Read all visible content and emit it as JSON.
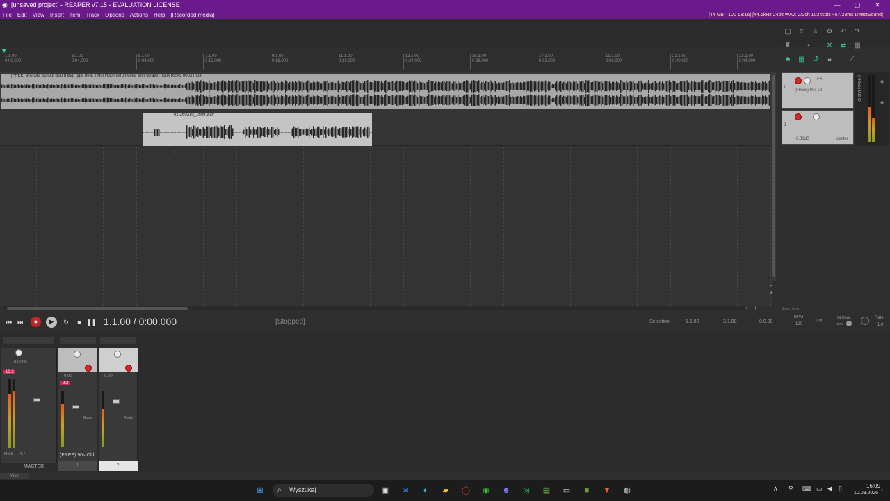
{
  "window": {
    "title": "[unsaved project] - REAPER v7.15 - EVALUATION LICENSE",
    "status_right": "[44 GB · 100 13:16] [44.1kHz 24bit WAV: 2/2ch 1024spls ~57/23ms DirectSound]",
    "controls": [
      "—",
      "▢",
      "✕"
    ]
  },
  "menu": [
    "File",
    "Edit",
    "View",
    "Insert",
    "Item",
    "Track",
    "Options",
    "Actions",
    "Help",
    "[Recorded media]"
  ],
  "ruler": {
    "ticks": [
      {
        "bar": "1.1.00",
        "time": "0:00.000"
      },
      {
        "bar": "3.1.00",
        "time": "0:04.000"
      },
      {
        "bar": "5.1.00",
        "time": "0:08.000"
      },
      {
        "bar": "7.1.00",
        "time": "0:12.000"
      },
      {
        "bar": "9.1.00",
        "time": "0:16.000"
      },
      {
        "bar": "11.1.00",
        "time": "0:20.000"
      },
      {
        "bar": "13.1.00",
        "time": "0:24.000"
      },
      {
        "bar": "15.1.00",
        "time": "0:28.000"
      },
      {
        "bar": "17.1.00",
        "time": "0:32.000"
      },
      {
        "bar": "19.1.00",
        "time": "0:36.000"
      },
      {
        "bar": "21.1.00",
        "time": "0:40.000"
      },
      {
        "bar": "23.1.00",
        "time": "0:44.000"
      }
    ]
  },
  "tracks": {
    "item1_label": "[FREE] 90s Old School Boom Bap type beat x Hip Hop instrumental with scratch hook REAL 0003.mp3",
    "item2_label": "02-260310_1609.wav",
    "tcp1": {
      "number": "1",
      "name": "(FREE) 90s Ol"
    },
    "tcp2": {
      "number": "2",
      "volume": "0.00dB",
      "pan": "center"
    }
  },
  "transport": {
    "position": "1.1.00 / 0:00.000",
    "state": "[Stopped]",
    "selection_label": "Selection:",
    "selection_start": "1.1.00",
    "selection_end": "3.1.00",
    "selection_length": "0.0.00",
    "bpm_label": "BPM",
    "bpm": "120",
    "timesig": "4/4",
    "global_label": "GLOBAL",
    "none_label": "none",
    "rate_label": "Rate:",
    "rate": "1.0",
    "select_item": "Select item"
  },
  "mixer": {
    "master": {
      "label": "MASTER",
      "peak": "-10.3",
      "rms_label": "RMS",
      "rms": "-4.7",
      "vol": "0.00dB"
    },
    "strip1": {
      "number": "1",
      "name": "(FREE) 90s Old",
      "vol": "0.00",
      "peak": "-9.3",
      "route": "Route"
    },
    "strip2": {
      "number": "2",
      "vol": "0.00",
      "route": "Route"
    },
    "tab": "Mixer"
  },
  "taskbar": {
    "search_placeholder": "Wyszukaj",
    "time": "16:09",
    "date": "10.03.2026"
  },
  "colors": {
    "titlebar": "#6a1a8a",
    "record": "#d02828",
    "item": "#a8a8a8",
    "accent": "#38c8a0"
  }
}
